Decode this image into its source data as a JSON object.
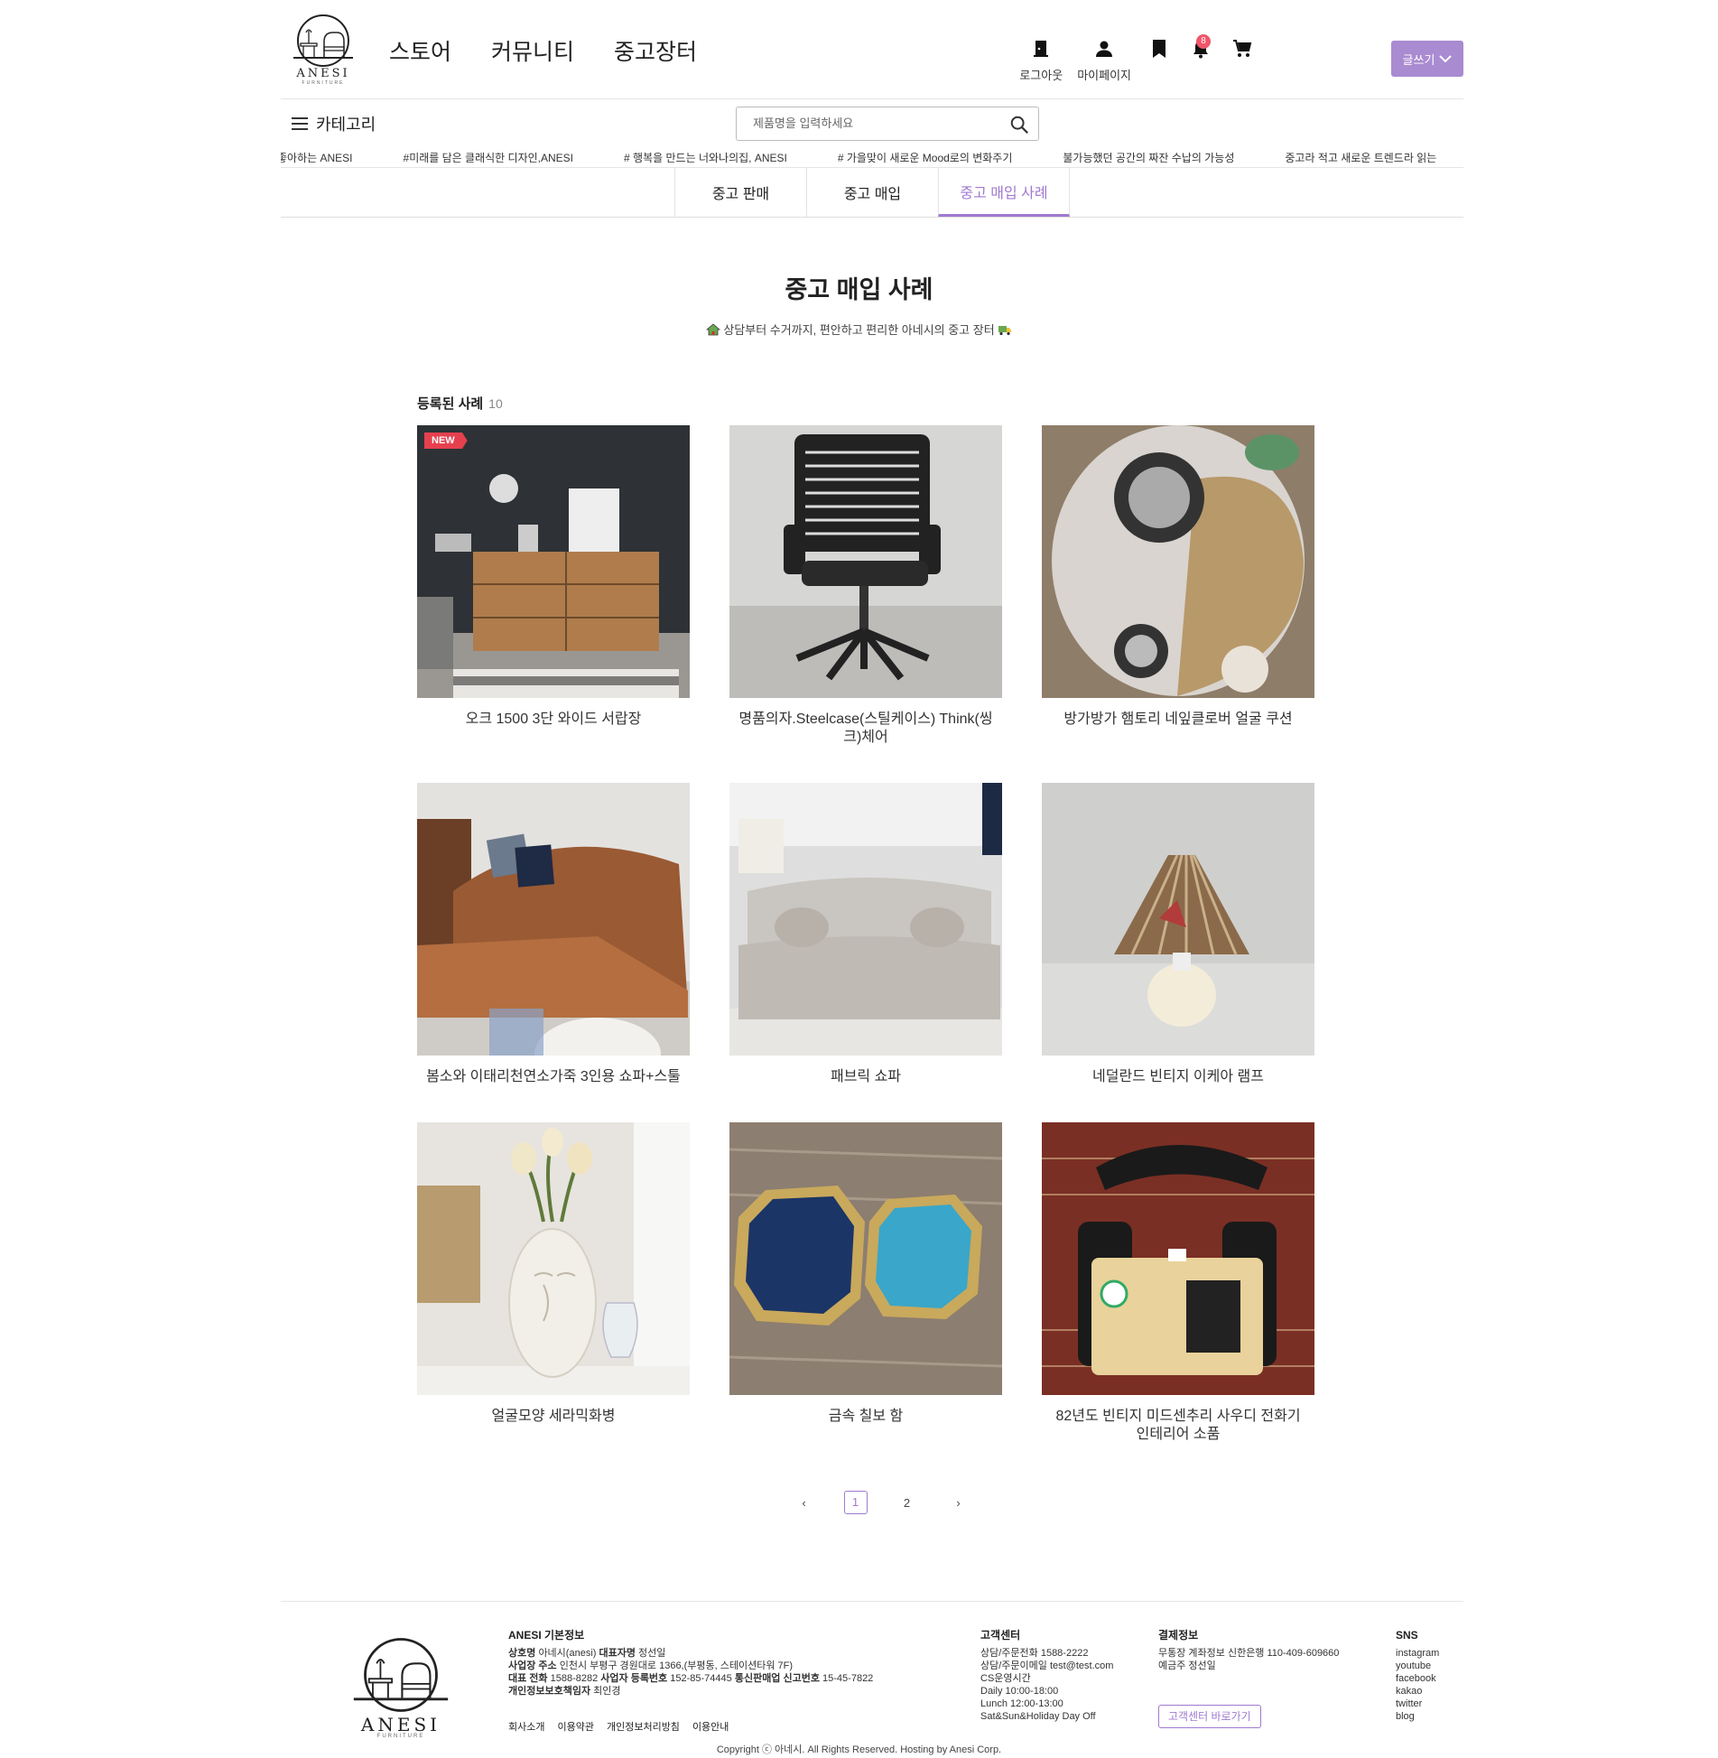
{
  "brand": {
    "name": "ANESI",
    "sub": "FURNITURE"
  },
  "nav": [
    "스토어",
    "커뮤니티",
    "중고장터"
  ],
  "user_menu": [
    {
      "icon": "logout-icon",
      "label": "로그아웃"
    },
    {
      "icon": "user-icon",
      "label": "마이페이지"
    },
    {
      "icon": "bookmark-icon",
      "label": ""
    },
    {
      "icon": "bell-icon",
      "label": "",
      "badge": "8"
    },
    {
      "icon": "cart-icon",
      "label": ""
    }
  ],
  "write_button": "글쓰기",
  "category_label": "카테고리",
  "search": {
    "placeholder": "제품명을 입력하세요"
  },
  "hashtags": [
    "좋아하는 ANESI",
    "#미래를 담은 클래식한 디자인,ANESI",
    "# 행복을 만드는 너와나의집, ANESI",
    "# 가을맞이 새로운 Mood로의 변화주기",
    "불가능했던 공간의 짜잔 수납의 가능성",
    "중고라 적고 새로운 트렌드라 읽는"
  ],
  "tabs": [
    "중고 판매",
    "중고 매입",
    "중고 매입 사례"
  ],
  "active_tab": 2,
  "page_title": "중고 매입 사례",
  "subtitle": "상담부터 수거까지, 편안하고 편리한 아네시의 중고 장터",
  "list_label": "등록된 사례",
  "list_count": "10",
  "new_badge": "NEW",
  "cases": [
    {
      "title": "오크 1500 3단 와이드 서랍장"
    },
    {
      "title": "명품의자.Steelcase(스틸케이스) Think(씽크)체어"
    },
    {
      "title": "방가방가 햄토리 네잎클로버 얼굴 쿠션"
    },
    {
      "title": "봄소와 이태리천연소가죽 3인용 쇼파+스툴"
    },
    {
      "title": "패브릭 쇼파"
    },
    {
      "title": "네덜란드 빈티지 이케아 램프"
    },
    {
      "title": "얼굴모양 세라믹화병"
    },
    {
      "title": "금속 칠보 함"
    },
    {
      "title": "82년도 빈티지 미드센추리 사우디 전화기 인테리어 소품"
    }
  ],
  "pagination": {
    "prev": "‹",
    "pages": [
      "1",
      "2"
    ],
    "current": "1",
    "next": "›"
  },
  "footer": {
    "info_title": "ANESI 기본정보",
    "company_label": "상호명",
    "company": "아네시(anesi)",
    "ceo_label": "대표자명",
    "ceo": "정선일",
    "address_label": "사업장 주소",
    "address": "인천시 부평구 경원대로 1366,(부평동, 스테이션타워 7F)",
    "phone_label": "대표 전화",
    "phone": "1588-8282",
    "bizno_label": "사업자 등록번호",
    "bizno": "152-85-74445",
    "mailorder_label": "통신판매업 신고번호",
    "mailorder": "15-45-7822",
    "privacy_label": "개인정보보호책임자",
    "privacy": "최인경",
    "links": [
      "회사소개",
      "이용약관",
      "개인정보처리방침",
      "이용안내"
    ],
    "cs_title": "고객센터",
    "cs_lines": [
      "상담/주문전화 1588-2222",
      "상담/주문이메일 test@test.com",
      "CS운영시간",
      "Daily 10:00-18:00",
      "Lunch 12:00-13:00",
      "Sat&Sun&Holiday Day Off"
    ],
    "pay_title": "결제정보",
    "pay_lines": [
      "무통장 계좌정보 신한은행 110-409-609660",
      "예금주 정선일"
    ],
    "cs_button": "고객센터 바로가기",
    "sns_title": "SNS",
    "sns": [
      "instagram",
      "youtube",
      "facebook",
      "kakao",
      "twitter",
      "blog"
    ],
    "copyright": "Copyright ⓒ 아네시. All Rights Reserved. Hosting by Anesi Corp."
  },
  "colors": {
    "accent": "#a07ad0",
    "button": "#a98bd1",
    "badge_red": "#e6404f"
  }
}
